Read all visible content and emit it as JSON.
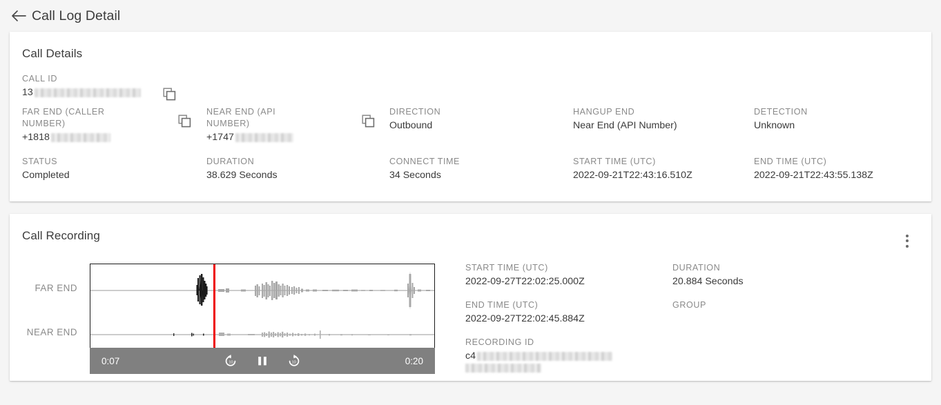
{
  "header": {
    "back_icon": "arrow-left-icon",
    "title": "Call Log Detail"
  },
  "call_details": {
    "title": "Call Details",
    "copy_icon": "copy-icon",
    "fields": {
      "call_id": {
        "label": "CALL ID",
        "value": "13",
        "redacted": true,
        "redact_width": 154,
        "copyable": true
      },
      "far_end": {
        "label": "FAR END (CALLER NUMBER)",
        "value": "+1818",
        "redacted": true,
        "redact_width": 86,
        "copyable": true
      },
      "near_end": {
        "label": "NEAR END (API NUMBER)",
        "value": "+1747",
        "redacted": true,
        "redact_width": 84,
        "copyable": true
      },
      "direction": {
        "label": "DIRECTION",
        "value": "Outbound"
      },
      "hangup_end": {
        "label": "HANGUP END",
        "value": "Near End (API Number)"
      },
      "detection": {
        "label": "DETECTION",
        "value": "Unknown"
      },
      "status": {
        "label": "STATUS",
        "value": "Completed"
      },
      "duration": {
        "label": "DURATION",
        "value": "38.629 Seconds"
      },
      "connect_time": {
        "label": "CONNECT TIME",
        "value": "34 Seconds"
      },
      "start_time": {
        "label": "START TIME (UTC)",
        "value": "2022-09-21T22:43:16.510Z"
      },
      "end_time": {
        "label": "END TIME (UTC)",
        "value": "2022-09-21T22:43:55.138Z"
      }
    }
  },
  "call_recording": {
    "title": "Call Recording",
    "menu_icon": "more-vertical-icon",
    "channels": {
      "far_end_label": "FAR END",
      "near_end_label": "NEAR END"
    },
    "player": {
      "current_time": "0:07",
      "total_time": "0:20",
      "playhead_position_percent": 35.6,
      "state": "playing",
      "replay_icon": "replay-10-icon",
      "pause_icon": "pause-icon",
      "forward_icon": "forward-10-icon",
      "bar_color": "#808080",
      "playhead_color": "#ee0000"
    },
    "meta": {
      "start_time": {
        "label": "START TIME (UTC)",
        "value": "2022-09-27T22:02:25.000Z"
      },
      "end_time": {
        "label": "END TIME (UTC)",
        "value": "2022-09-27T22:02:45.884Z"
      },
      "recording_id": {
        "label": "RECORDING ID",
        "value": "c4",
        "redacted": true,
        "redact_width": 196,
        "redact_width_2": 110
      },
      "duration": {
        "label": "DURATION",
        "value": "20.884 Seconds"
      },
      "group": {
        "label": "GROUP",
        "value": ""
      }
    }
  },
  "theme": {
    "page_bg": "#f5f5f5",
    "card_bg": "#ffffff",
    "label_color": "#8a8a8a",
    "value_color": "#3a3a3a",
    "accent_red": "#ee0000"
  }
}
